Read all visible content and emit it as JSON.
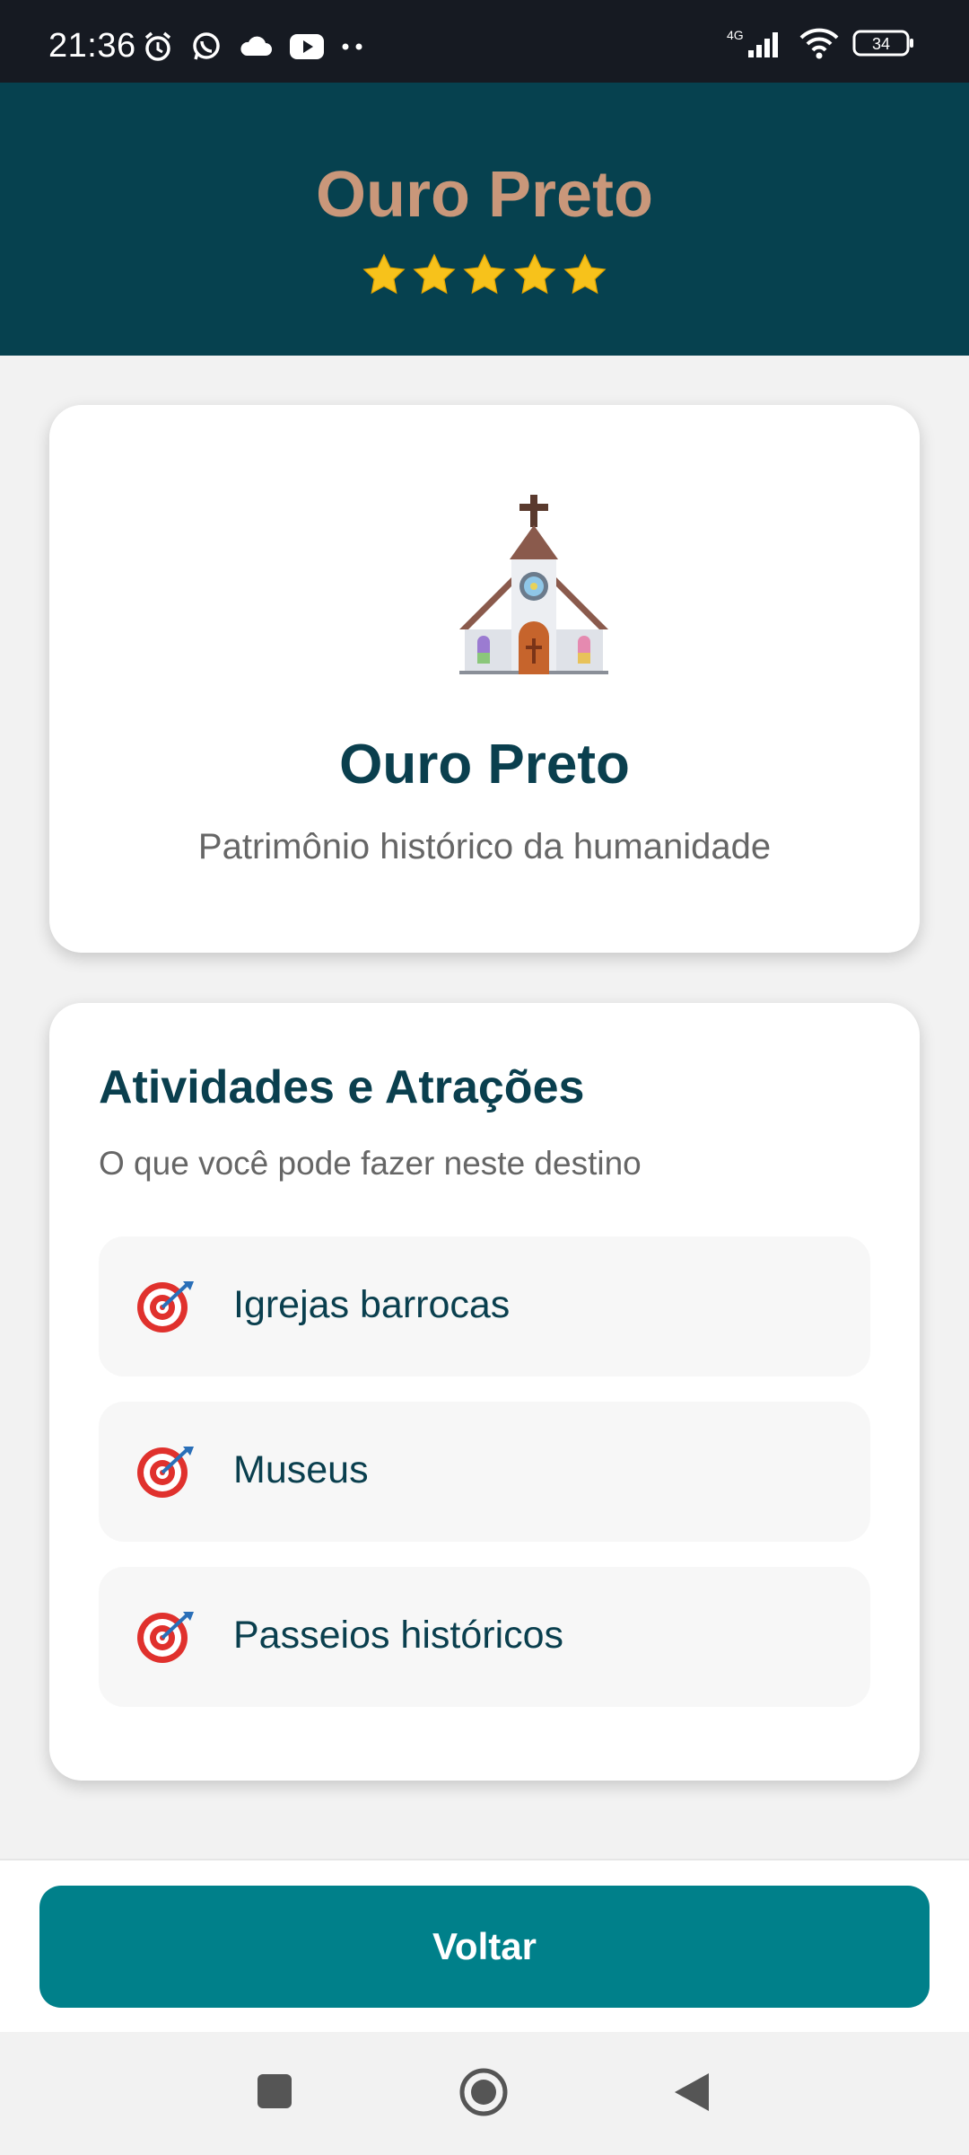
{
  "status_bar": {
    "time": "21:36",
    "left_icons": [
      "alarm-icon",
      "whatsapp-icon",
      "cloud-icon",
      "youtube-icon",
      "more-dots-icon"
    ],
    "network": "4G",
    "battery": "34"
  },
  "header": {
    "title": "Ouro Preto",
    "rating": 5,
    "stars": [
      "★",
      "★",
      "★",
      "★",
      "★"
    ]
  },
  "hero": {
    "icon": "church-icon",
    "title": "Ouro Preto",
    "subtitle": "Patrimônio histórico da humanidade"
  },
  "activities": {
    "title": "Atividades e Atrações",
    "subtitle": "O que você pode fazer neste destino",
    "items": [
      {
        "icon": "target-icon",
        "label": "Igrejas barrocas"
      },
      {
        "icon": "target-icon",
        "label": "Museus"
      },
      {
        "icon": "target-icon",
        "label": "Passeios históricos"
      }
    ]
  },
  "footer": {
    "back_label": "Voltar"
  },
  "navigation": [
    "recents-square-icon",
    "home-circle-icon",
    "back-triangle-icon"
  ],
  "colors": {
    "header_bg": "#06414f",
    "header_title": "#c9977a",
    "primary_text": "#0a3f4e",
    "button_bg": "#00808a",
    "star": "#f7c21b"
  }
}
